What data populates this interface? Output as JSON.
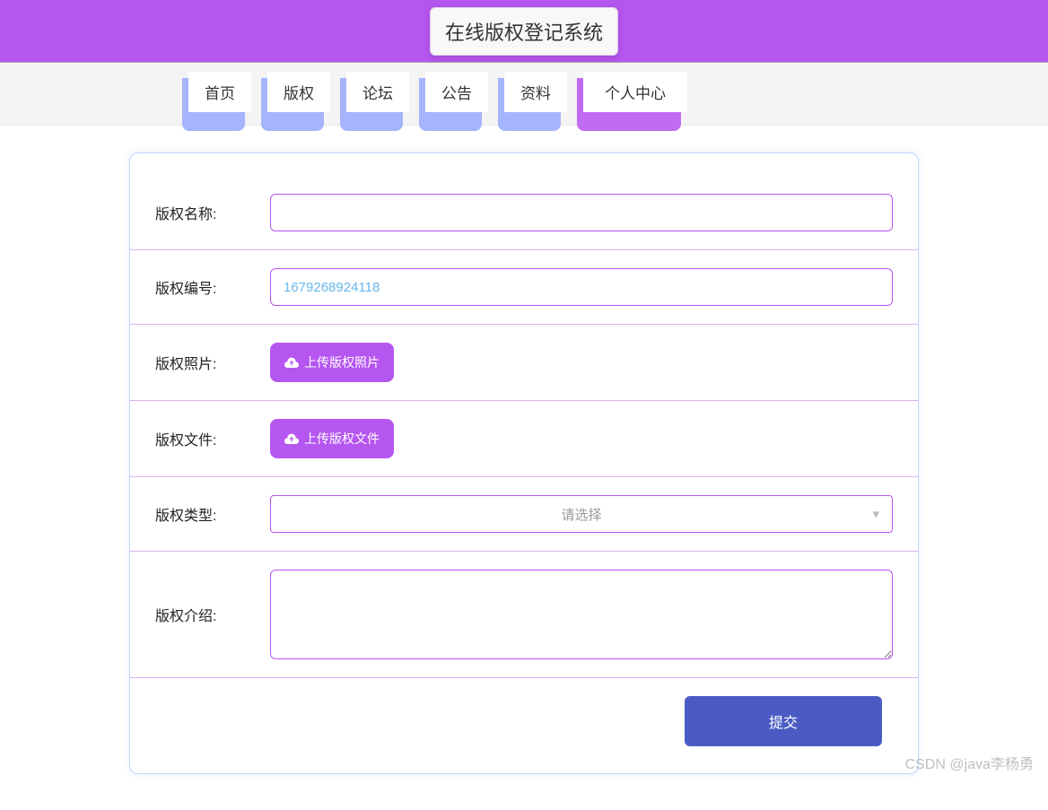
{
  "header": {
    "title": "在线版权登记系统"
  },
  "nav": {
    "items": [
      {
        "label": "首页"
      },
      {
        "label": "版权"
      },
      {
        "label": "论坛"
      },
      {
        "label": "公告"
      },
      {
        "label": "资料"
      },
      {
        "label": "个人中心"
      }
    ],
    "active_index": 5
  },
  "form": {
    "copyright_name": {
      "label": "版权名称:",
      "value": ""
    },
    "copyright_number": {
      "label": "版权编号:",
      "value": "1679268924118"
    },
    "copyright_photo": {
      "label": "版权照片:",
      "button": "上传版权照片"
    },
    "copyright_file": {
      "label": "版权文件:",
      "button": "上传版权文件"
    },
    "copyright_type": {
      "label": "版权类型:",
      "placeholder": "请选择"
    },
    "copyright_intro": {
      "label": "版权介绍:",
      "value": ""
    },
    "submit": "提交"
  },
  "watermark": "CSDN @java李杨勇"
}
